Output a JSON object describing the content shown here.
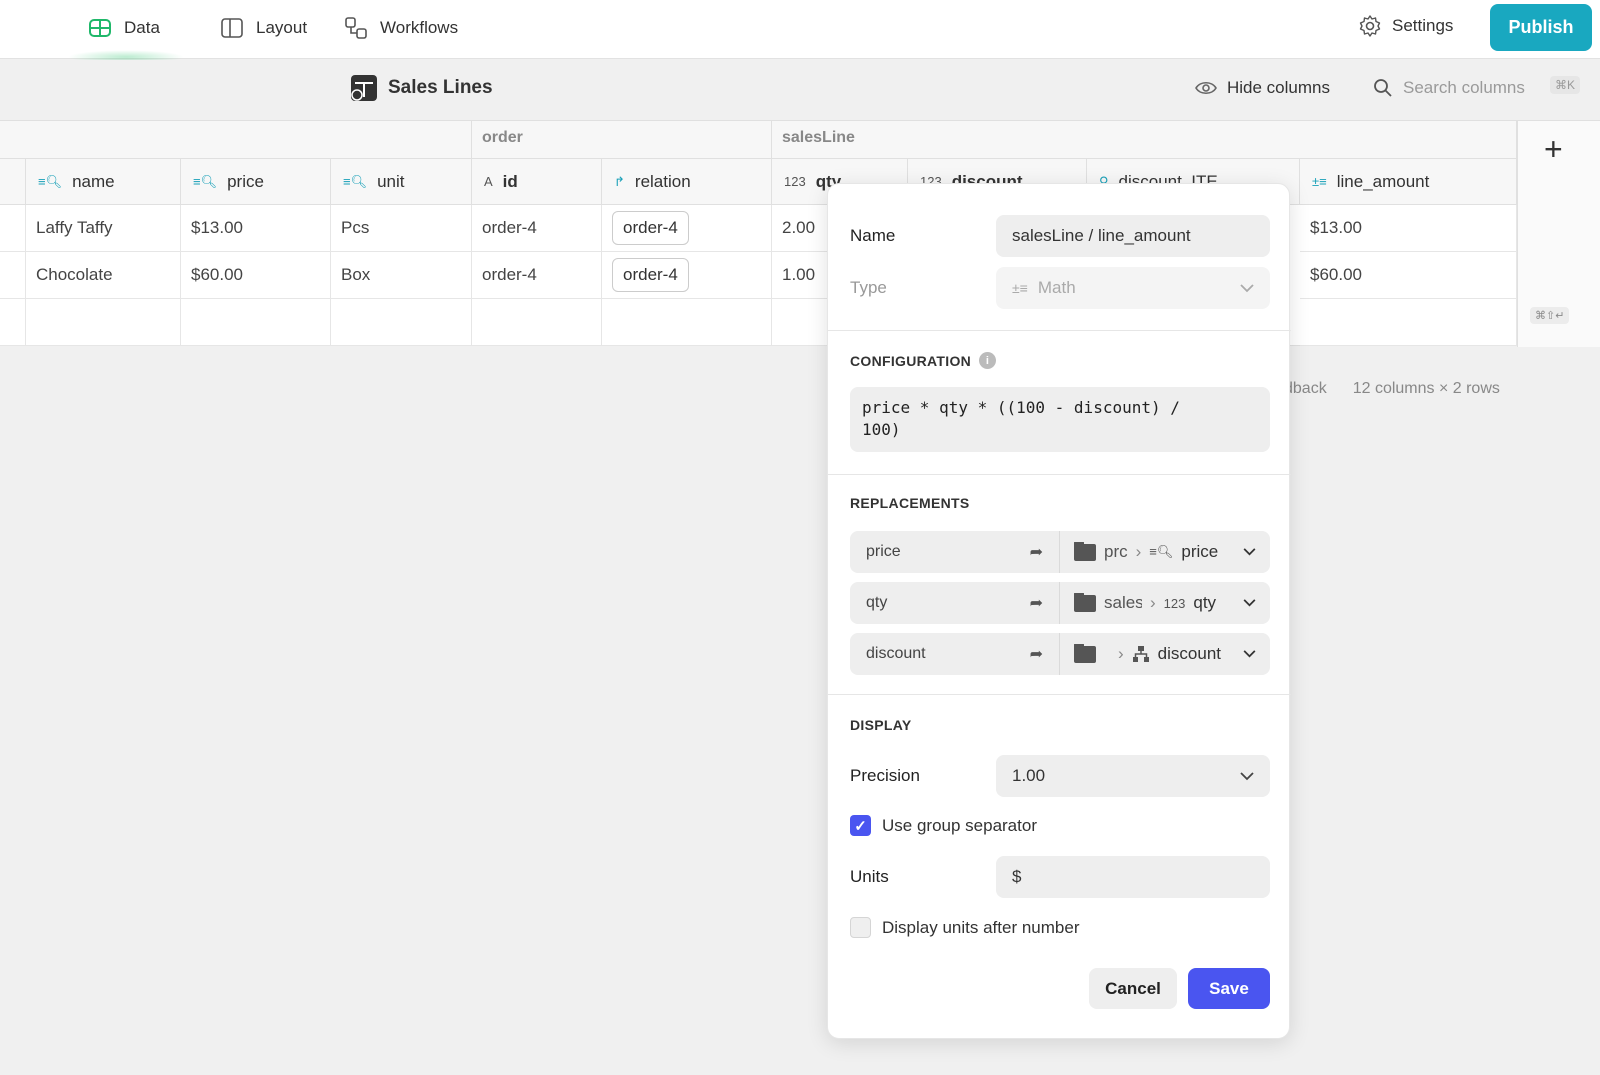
{
  "nav": {
    "data": "Data",
    "layout": "Layout",
    "workflows": "Workflows",
    "settings": "Settings",
    "publish": "Publish"
  },
  "table": {
    "title": "Sales Lines",
    "hide_columns": "Hide columns",
    "search_placeholder": "Search columns",
    "search_shortcut": "⌘K",
    "groups": {
      "order": "order",
      "salesLine": "salesLine"
    },
    "columns": [
      "name",
      "price",
      "unit",
      "id",
      "relation",
      "qty",
      "discount",
      "discount_ITE",
      "line_amount"
    ],
    "rows": [
      {
        "name": "Laffy Taffy",
        "price": "$13.00",
        "unit": "Pcs",
        "id": "order-4",
        "relation": "order-4",
        "qty": "2.00",
        "line_amount": "$13.00"
      },
      {
        "name": "Chocolate",
        "price": "$60.00",
        "unit": "Box",
        "id": "order-4",
        "relation": "order-4",
        "qty": "1.00",
        "line_amount": "$60.00"
      }
    ],
    "add_shortcut": "⌘⇧↵",
    "feedback_fragment": "dback",
    "summary": "12 columns × 2 rows"
  },
  "panel": {
    "name_label": "Name",
    "name_value": "salesLine / line_amount",
    "type_label": "Type",
    "type_value": "Math",
    "configuration_title": "CONFIGURATION",
    "formula": "price * qty * ((100 - discount) /\n100)",
    "replacements_title": "REPLACEMENTS",
    "replacements": [
      {
        "var": "price",
        "crumb": "prc",
        "target": "price"
      },
      {
        "var": "qty",
        "crumb": "sales",
        "type": "123",
        "target": "qty"
      },
      {
        "var": "discount",
        "crumb": "",
        "target": "discount"
      }
    ],
    "display_title": "DISPLAY",
    "precision_label": "Precision",
    "precision_value": "1.00",
    "group_separator_label": "Use group separator",
    "group_separator_checked": true,
    "units_label": "Units",
    "units_value": "$",
    "units_after_label": "Display units after number",
    "units_after_checked": false,
    "cancel": "Cancel",
    "save": "Save"
  },
  "colors": {
    "publish": "#19a8c0",
    "primary": "#4a55f0",
    "teal": "#19a0b8"
  }
}
